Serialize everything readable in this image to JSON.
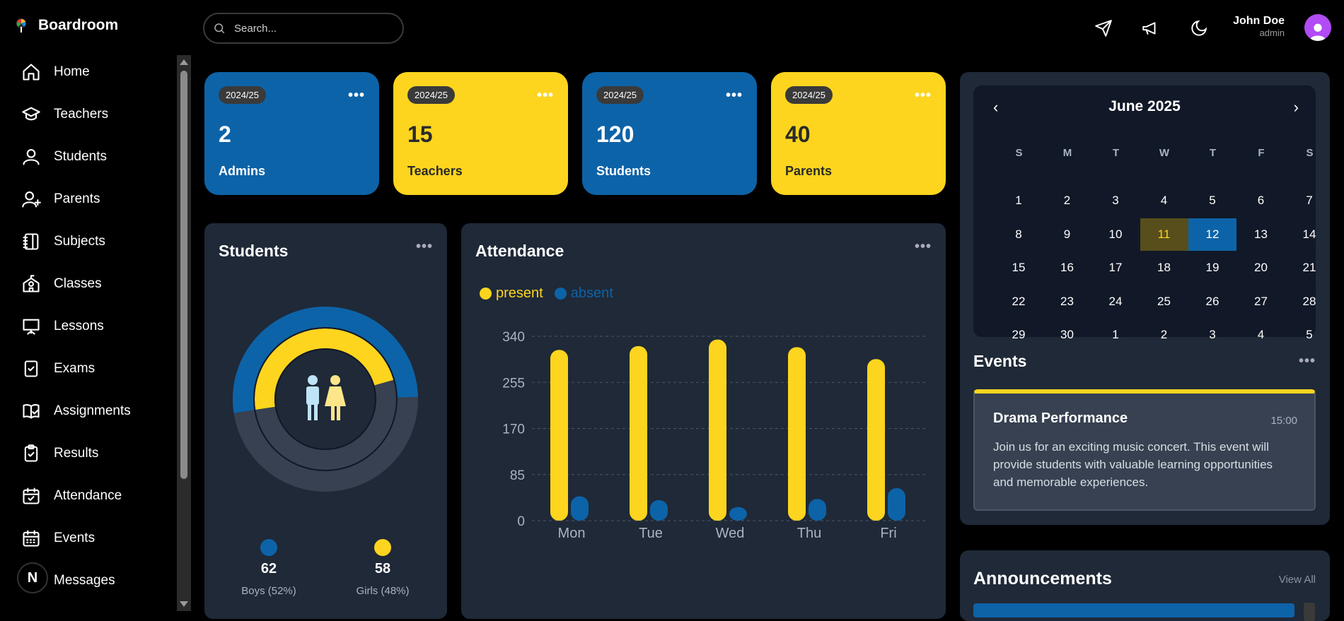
{
  "app": {
    "title": "Boardroom"
  },
  "search": {
    "placeholder": "Search..."
  },
  "user": {
    "name": "John Doe",
    "role": "admin"
  },
  "sidebar": {
    "items": [
      {
        "label": "Home",
        "icon": "home-icon"
      },
      {
        "label": "Teachers",
        "icon": "graduation-cap-icon"
      },
      {
        "label": "Students",
        "icon": "user-icon"
      },
      {
        "label": "Parents",
        "icon": "user-plus-icon"
      },
      {
        "label": "Subjects",
        "icon": "notebook-icon"
      },
      {
        "label": "Classes",
        "icon": "school-icon"
      },
      {
        "label": "Lessons",
        "icon": "presentation-icon"
      },
      {
        "label": "Exams",
        "icon": "clipboard-check-icon"
      },
      {
        "label": "Assignments",
        "icon": "book-check-icon"
      },
      {
        "label": "Results",
        "icon": "clipboard-result-icon"
      },
      {
        "label": "Attendance",
        "icon": "calendar-check-icon"
      },
      {
        "label": "Events",
        "icon": "calendar-grid-icon"
      },
      {
        "label": "Messages",
        "icon": "message-icon"
      }
    ],
    "badge": "N"
  },
  "stat_cards": [
    {
      "year": "2024/25",
      "value": "2",
      "label": "Admins",
      "color": "#0d63a8"
    },
    {
      "year": "2024/25",
      "value": "15",
      "label": "Teachers",
      "color": "#fdd51e"
    },
    {
      "year": "2024/25",
      "value": "120",
      "label": "Students",
      "color": "#0d63a8"
    },
    {
      "year": "2024/25",
      "value": "40",
      "label": "Parents",
      "color": "#fdd51e"
    }
  ],
  "students_panel": {
    "title": "Students",
    "boys_count": "62",
    "boys_label": "Boys (52%)",
    "girls_count": "58",
    "girls_label": "Girls (48%)",
    "boys_fraction": 0.52,
    "girls_fraction": 0.48,
    "boys_color": "#0d63a8",
    "girls_color": "#fdd51e"
  },
  "attendance_panel": {
    "title": "Attendance",
    "legend_present": "present",
    "legend_absent": "absent"
  },
  "chart_data": {
    "type": "bar",
    "title": "Attendance",
    "categories": [
      "Mon",
      "Tue",
      "Wed",
      "Thu",
      "Fri"
    ],
    "series": [
      {
        "name": "present",
        "color": "#fdd51e",
        "values": [
          315,
          322,
          334,
          320,
          298
        ]
      },
      {
        "name": "absent",
        "color": "#0d63a8",
        "values": [
          45,
          38,
          25,
          40,
          60
        ]
      }
    ],
    "yticks": [
      "0",
      "85",
      "170",
      "255",
      "340"
    ],
    "ylim": [
      0,
      340
    ],
    "grid": true,
    "legend": "top-left"
  },
  "calendar": {
    "title": "June 2025",
    "prev": "‹",
    "next": "›",
    "weekdays": [
      "S",
      "M",
      "T",
      "W",
      "T",
      "F",
      "S"
    ],
    "days": [
      [
        "1",
        "2",
        "3",
        "4",
        "5",
        "6",
        "7"
      ],
      [
        "8",
        "9",
        "10",
        "11",
        "12",
        "13",
        "14"
      ],
      [
        "15",
        "16",
        "17",
        "18",
        "19",
        "20",
        "21"
      ],
      [
        "22",
        "23",
        "24",
        "25",
        "26",
        "27",
        "28"
      ],
      [
        "29",
        "30",
        "1",
        "2",
        "3",
        "4",
        "5"
      ]
    ],
    "today": "11",
    "selected": "12",
    "today_color": "#574e1c",
    "selected_color": "#0d63a8"
  },
  "events": {
    "title": "Events",
    "items": [
      {
        "title": "Drama Performance",
        "time": "15:00",
        "description": "Join us for an exciting music concert. This event will provide students with valuable learning opportunities and memorable experiences."
      }
    ]
  },
  "announcements": {
    "title": "Announcements",
    "view_all": "View All"
  }
}
